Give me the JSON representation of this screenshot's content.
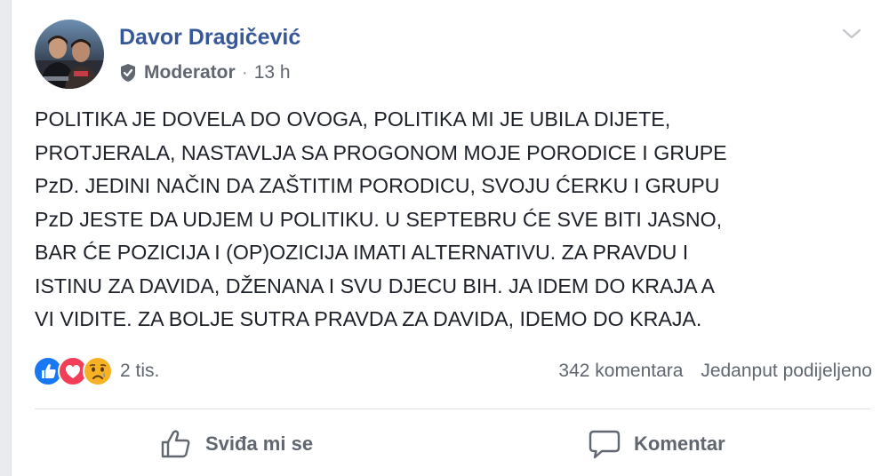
{
  "post": {
    "author": "Davor Dragičević",
    "role": "Moderator",
    "separator": "·",
    "time": "13 h",
    "text": "POLITIKA JE DOVELA DO OVOGA, POLITIKA MI JE UBILA DIJETE,\nPROTJERALA, NASTAVLJA SA PROGONOM MOJE PORODICE I GRUPE\nPzD. JEDINI NAČIN DA ZAŠTITIM PORODICU, SVOJU ĆERKU I GRUPU\nPzD JESTE DA UDJEM U POLITIKU. U SEPTEBRU ĆE SVE BITI JASNO,\nBAR ĆE POZICIJA I (OP)OZICIJA IMATI ALTERNATIVU. ZA PRAVDU I\nISTINU ZA DAVIDA, DŽENANA I SVU DJECU BIH. JA IDEM DO KRAJA A\nVI VIDITE. ZA BOLJE SUTRA PRAVDA ZA DAVIDA, IDEMO DO KRAJA."
  },
  "stats": {
    "reactions_count": "2 tis.",
    "comments": "342 komentara",
    "shares": "Jedanput podijeljeno",
    "reaction_icons": [
      "like-icon",
      "love-icon",
      "sad-icon"
    ]
  },
  "actions": {
    "like_label": "Sviđa mi se",
    "comment_label": "Komentar"
  },
  "colors": {
    "author": "#365899",
    "like": "#1877f2",
    "love": "#f33e58",
    "sad": "#f7b125",
    "meta": "#616770"
  }
}
